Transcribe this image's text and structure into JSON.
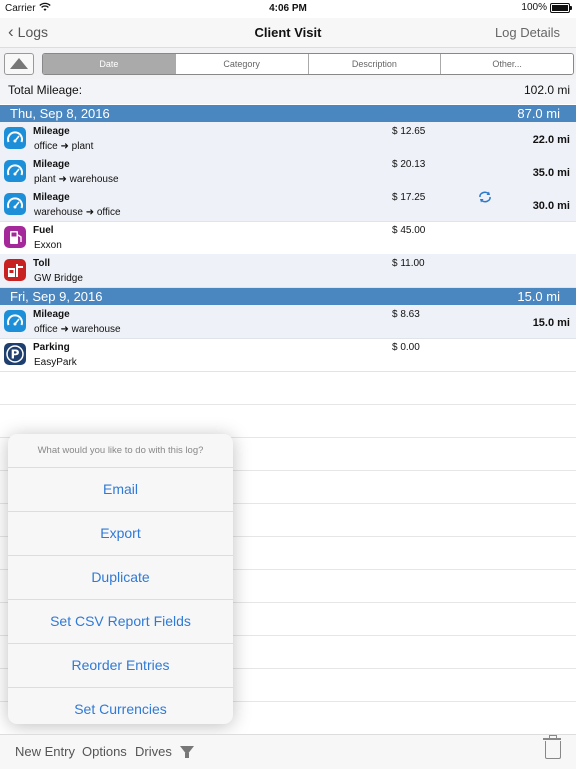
{
  "status": {
    "carrier": "Carrier",
    "time": "4:06 PM",
    "battery": "100%"
  },
  "nav": {
    "back_label": "Logs",
    "title": "Client Visit",
    "right_label": "Log Details"
  },
  "segments": [
    "Date",
    "Category",
    "Description",
    "Other..."
  ],
  "total": {
    "label": "Total Mileage:",
    "value": "102.0 mi"
  },
  "days": [
    {
      "date": "Thu, Sep 8, 2016",
      "miles": "87.0 mi",
      "entries": [
        {
          "category": "Mileage",
          "from": "office",
          "to": "plant",
          "amount": "$ 12.65",
          "miles": "22.0 mi",
          "icon": "speedometer-icon"
        },
        {
          "category": "Mileage",
          "from": "plant",
          "to": "warehouse",
          "amount": "$ 20.13",
          "miles": "35.0 mi",
          "icon": "speedometer-icon"
        },
        {
          "category": "Mileage",
          "from": "warehouse",
          "to": "office",
          "amount": "$ 17.25",
          "miles": "30.0 mi",
          "icon": "speedometer-icon",
          "sync": true
        },
        {
          "category": "Fuel",
          "desc": "Exxon",
          "amount": "$ 45.00",
          "icon": "fuel-pump-icon"
        },
        {
          "category": "Toll",
          "desc": "GW Bridge",
          "amount": "$ 11.00",
          "icon": "toll-icon"
        }
      ]
    },
    {
      "date": "Fri, Sep 9, 2016",
      "miles": "15.0 mi",
      "entries": [
        {
          "category": "Mileage",
          "from": "office",
          "to": "warehouse",
          "amount": "$ 8.63",
          "miles": "15.0 mi",
          "icon": "speedometer-icon"
        },
        {
          "category": "Parking",
          "desc": "EasyPark",
          "amount": "$ 0.00",
          "icon": "parking-icon"
        }
      ]
    }
  ],
  "sheet": {
    "header": "What would you like to do with this log?",
    "options": [
      "Email",
      "Export",
      "Duplicate",
      "Set CSV Report Fields",
      "Reorder Entries",
      "Set Currencies"
    ]
  },
  "toolbar": {
    "new_entry": "New Entry",
    "options": "Options",
    "drives": "Drives"
  },
  "colors": {
    "day_header": "#4a86c0",
    "accent": "#2f7ad6"
  }
}
